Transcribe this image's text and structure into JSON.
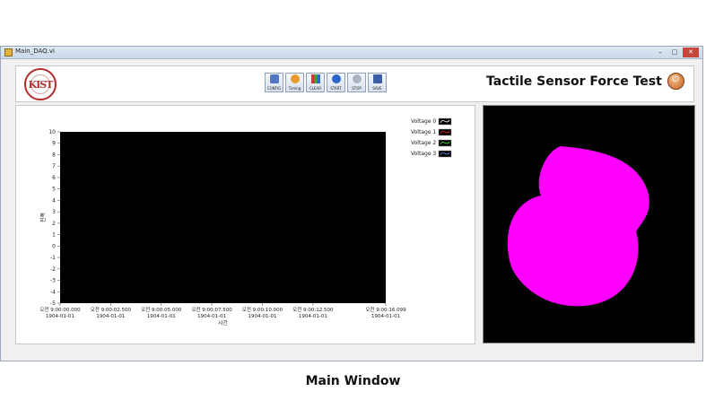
{
  "window": {
    "title": "Main_DAQ.vi"
  },
  "app": {
    "title": "Tactile Sensor Force Test",
    "logo_text": "KIST"
  },
  "toolbar": {
    "buttons": [
      {
        "label": "CONFIG",
        "icon": "config-icon"
      },
      {
        "label": "Timing",
        "icon": "timing-icon"
      },
      {
        "label": "CLEAR",
        "icon": "clear-icon"
      },
      {
        "label": "START",
        "icon": "start-icon"
      },
      {
        "label": "STOP",
        "icon": "stop-icon"
      },
      {
        "label": "SAVE",
        "icon": "save-icon"
      }
    ]
  },
  "chart_data": {
    "type": "line",
    "title": "",
    "xlabel": "시간",
    "ylabel": "진폭",
    "ylim": [
      -5,
      10
    ],
    "yticks": [
      "10",
      "9",
      "8",
      "7",
      "6",
      "5",
      "4",
      "3",
      "2",
      "1",
      "0",
      "-1",
      "-2",
      "-3",
      "-4",
      "-5"
    ],
    "xticks": [
      {
        "time": "오전 9:00:00.000",
        "date": "1904-01-01"
      },
      {
        "time": "오전 9:00:02.500",
        "date": "1904-01-01"
      },
      {
        "time": "오전 9:00:05.000",
        "date": "1904-01-01"
      },
      {
        "time": "오전 9:00:07.500",
        "date": "1904-01-01"
      },
      {
        "time": "오전 9:00:10.000",
        "date": "1904-01-01"
      },
      {
        "time": "오전 9:00:12.500",
        "date": "1904-01-01"
      },
      {
        "time": "오전 9:00:16.099",
        "date": "1904-01-01"
      }
    ],
    "xtick_seconds": [
      0,
      2.5,
      5,
      7.5,
      10,
      12.5,
      16.099
    ],
    "xlim_seconds": [
      0,
      16.099
    ],
    "series": [
      {
        "name": "Voltage 0",
        "color": "#ffffff",
        "values": []
      },
      {
        "name": "Voltage 1",
        "color": "#ff3030",
        "values": []
      },
      {
        "name": "Voltage 2",
        "color": "#30ff30",
        "values": []
      },
      {
        "name": "Voltage 3",
        "color": "#60a0ff",
        "values": []
      }
    ],
    "plot_background": "#000000",
    "legend": "top-right"
  },
  "pressure_view": {
    "background": "#000000",
    "blob_color": "#ff00ff"
  },
  "caption": "Main Window"
}
